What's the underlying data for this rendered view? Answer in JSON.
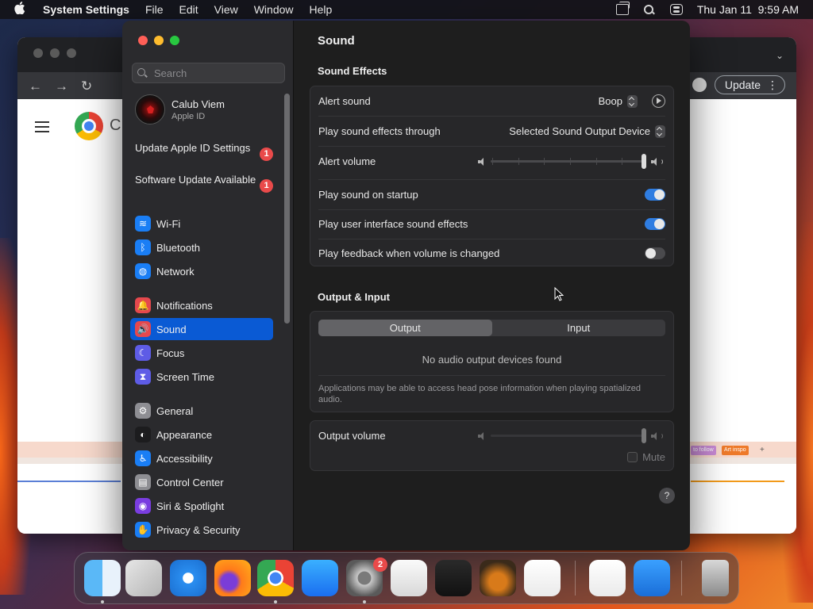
{
  "menubar": {
    "app_name": "System Settings",
    "items": [
      "File",
      "Edit",
      "View",
      "Window",
      "Help"
    ],
    "clock": "Thu Jan 11  9:59 AM"
  },
  "chrome": {
    "update_label": "Update",
    "logo_partial_text": "C",
    "chips": [
      "to follow",
      "Art inspo",
      "+"
    ]
  },
  "sidebar": {
    "search_placeholder": "Search",
    "user": {
      "name": "Calub Viem",
      "subtitle": "Apple ID"
    },
    "alerts": [
      {
        "label": "Update Apple ID Settings",
        "badge": "1"
      },
      {
        "label": "Software Update Available",
        "badge": "1"
      }
    ],
    "items": [
      {
        "label": "Wi-Fi",
        "icon": "wifi-icon",
        "color": "#1a7ef5"
      },
      {
        "label": "Bluetooth",
        "icon": "bluetooth-icon",
        "color": "#1a7ef5"
      },
      {
        "label": "Network",
        "icon": "globe-icon",
        "color": "#1a7ef5"
      },
      {
        "label": "Notifications",
        "icon": "bell-icon",
        "color": "#e5484d"
      },
      {
        "label": "Sound",
        "icon": "speaker-icon",
        "color": "#e5484d",
        "selected": true
      },
      {
        "label": "Focus",
        "icon": "moon-icon",
        "color": "#5e5ce6"
      },
      {
        "label": "Screen Time",
        "icon": "hourglass-icon",
        "color": "#5e5ce6"
      },
      {
        "label": "General",
        "icon": "gear-icon",
        "color": "#8e8e93"
      },
      {
        "label": "Appearance",
        "icon": "appearance-icon",
        "color": "#1c1c1e"
      },
      {
        "label": "Accessibility",
        "icon": "accessibility-icon",
        "color": "#1a7ef5"
      },
      {
        "label": "Control Center",
        "icon": "control-center-icon",
        "color": "#8e8e93"
      },
      {
        "label": "Siri & Spotlight",
        "icon": "siri-icon",
        "color": "#7a3de0"
      },
      {
        "label": "Privacy & Security",
        "icon": "hand-icon",
        "color": "#1a7ef5"
      }
    ]
  },
  "content": {
    "title": "Sound",
    "sound_effects": {
      "section_title": "Sound Effects",
      "alert_sound_label": "Alert sound",
      "alert_sound_value": "Boop",
      "play_through_label": "Play sound effects through",
      "play_through_value": "Selected Sound Output Device",
      "alert_volume_label": "Alert volume",
      "alert_volume_level": 1.0,
      "startup_label": "Play sound on startup",
      "startup_on": true,
      "ui_effects_label": "Play user interface sound effects",
      "ui_effects_on": true,
      "feedback_label": "Play feedback when volume is changed",
      "feedback_on": false
    },
    "output_input": {
      "section_title": "Output & Input",
      "tab_output": "Output",
      "tab_input": "Input",
      "active_tab": "Output",
      "empty_message": "No audio output devices found",
      "note": "Applications may be able to access head pose information when playing spatialized audio."
    },
    "output_volume": {
      "label": "Output volume",
      "level": 1.0,
      "mute_label": "Mute"
    },
    "help_label": "?"
  },
  "dock": {
    "settings_badge": "2",
    "apps": [
      "finder-icon",
      "launchpad-icon",
      "safari-icon",
      "firefox-icon",
      "chrome-icon",
      "app-store-icon",
      "system-settings-icon",
      "textedit-icon",
      "terminal-icon",
      "garageband-icon",
      "vscode-icon",
      "visual-studio-icon",
      "weather-icon",
      "trash-icon"
    ]
  }
}
